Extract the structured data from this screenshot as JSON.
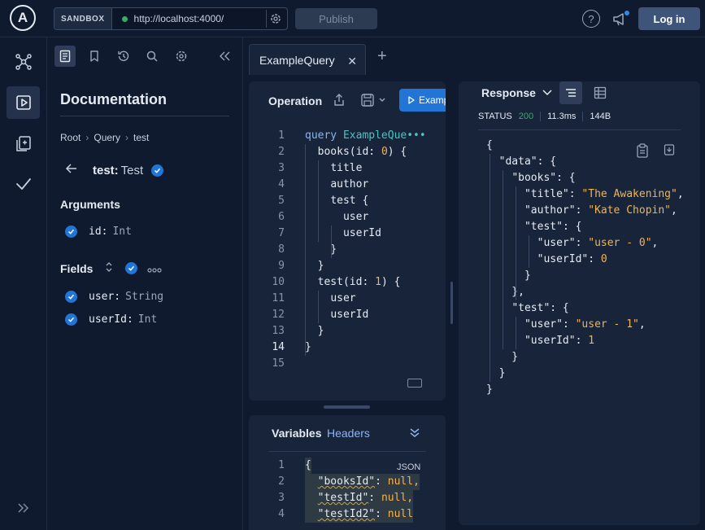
{
  "topbar": {
    "logo_letter": "A",
    "sandbox_label": "SANDBOX",
    "url": "http://localhost:4000/",
    "publish_label": "Publish",
    "help_glyph": "?",
    "login_label": "Log in"
  },
  "rail": {
    "icons": [
      "schema-icon",
      "explorer-icon",
      "checks-icon",
      "operation-collections-icon",
      "expand-icon"
    ]
  },
  "docs": {
    "title": "Documentation",
    "breadcrumbs": [
      "Root",
      "Query",
      "test"
    ],
    "breadcrumb_sep": "›",
    "field_name": "test:",
    "field_type": "Test",
    "arguments_heading": "Arguments",
    "arguments": [
      {
        "name": "id:",
        "type": "Int"
      }
    ],
    "fields_heading": "Fields",
    "fields": [
      {
        "name": "user:",
        "type": "String"
      },
      {
        "name": "userId:",
        "type": "Int"
      }
    ]
  },
  "tabs": {
    "active": "ExampleQuery",
    "close_glyph": "✕",
    "add_glyph": "+"
  },
  "operation": {
    "title": "Operation",
    "run_label": "Examp",
    "current_line": 14,
    "lines": [
      {
        "n": "1",
        "t": "query ExampleQue•••"
      },
      {
        "n": "2",
        "t": "  books(id: 0) {"
      },
      {
        "n": "3",
        "t": "    title"
      },
      {
        "n": "4",
        "t": "    author"
      },
      {
        "n": "5",
        "t": "    test {"
      },
      {
        "n": "6",
        "t": "      user"
      },
      {
        "n": "7",
        "t": "      userId"
      },
      {
        "n": "8",
        "t": "    }"
      },
      {
        "n": "9",
        "t": "  }"
      },
      {
        "n": "10",
        "t": "  test(id: 1) {"
      },
      {
        "n": "11",
        "t": "    user"
      },
      {
        "n": "12",
        "t": "    userId"
      },
      {
        "n": "13",
        "t": "  }"
      },
      {
        "n": "14",
        "t": "}"
      },
      {
        "n": "15",
        "t": ""
      }
    ]
  },
  "variables": {
    "tab_label": "Variables",
    "headers_label": "Headers",
    "json_label": "JSON",
    "lines": [
      {
        "n": "1",
        "t": "{"
      },
      {
        "n": "2",
        "k": "\"booksId\"",
        "v": "null,"
      },
      {
        "n": "3",
        "k": "\"testId\"",
        "v": "null,"
      },
      {
        "n": "4",
        "k": "\"testId2\"",
        "v": "null"
      }
    ]
  },
  "response": {
    "title": "Response",
    "status_label": "STATUS",
    "status_code": "200",
    "time": "11.3ms",
    "size": "144B",
    "lines": [
      "{",
      "  \"data\": {",
      "    \"books\": {",
      "      \"title\": \"The Awakening\",",
      "      \"author\": \"Kate Chopin\",",
      "      \"test\": {",
      "        \"user\": \"user - 0\",",
      "        \"userId\": 0",
      "      }",
      "    },",
      "    \"test\": {",
      "      \"user\": \"user - 1\",",
      "      \"userId\": 1",
      "    }",
      "  }",
      "}"
    ]
  },
  "colors": {
    "accent": "#2075d6",
    "status_ok": "#36ad6b",
    "string": "#f0b454",
    "keyword": "#8cb4f0"
  }
}
